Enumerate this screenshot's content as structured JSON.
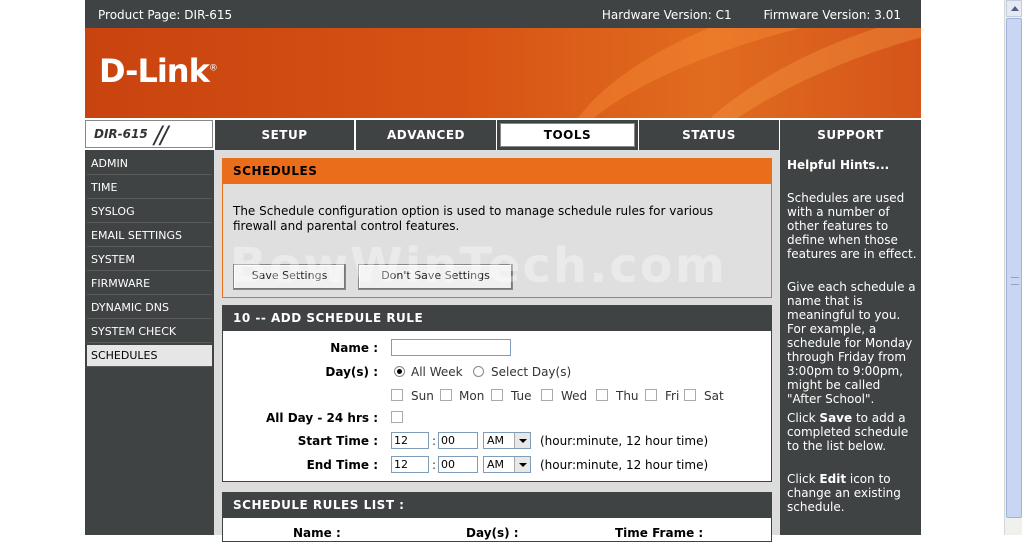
{
  "topbar": {
    "product": "Product Page: DIR-615",
    "hardware": "Hardware Version: C1",
    "firmware": "Firmware Version: 3.01"
  },
  "banner": {
    "logo": "D-Link",
    "logo_mark": "®"
  },
  "model": {
    "name": "DIR-615"
  },
  "nav": {
    "tabs": [
      {
        "label": "SETUP"
      },
      {
        "label": "ADVANCED"
      },
      {
        "label": "TOOLS",
        "active": true
      },
      {
        "label": "STATUS"
      },
      {
        "label": "SUPPORT"
      }
    ]
  },
  "sidebar": {
    "items": [
      {
        "label": "ADMIN"
      },
      {
        "label": "TIME"
      },
      {
        "label": "SYSLOG"
      },
      {
        "label": "EMAIL SETTINGS"
      },
      {
        "label": "SYSTEM"
      },
      {
        "label": "FIRMWARE"
      },
      {
        "label": "DYNAMIC DNS"
      },
      {
        "label": "SYSTEM CHECK"
      },
      {
        "label": "SCHEDULES",
        "active": true
      }
    ]
  },
  "schedules": {
    "title": "SCHEDULES",
    "description": "The Schedule configuration option is used to manage schedule rules for various firewall and parental control features.",
    "save_label": "Save Settings",
    "dont_save_label": "Don't Save Settings"
  },
  "add_rule": {
    "title": "10 -- ADD SCHEDULE RULE",
    "name_label": "Name :",
    "name_value": "",
    "days_label": "Day(s) :",
    "all_week": "All Week",
    "select_days": "Select Day(s)",
    "days": [
      "Sun",
      "Mon",
      "Tue",
      "Wed",
      "Thu",
      "Fri",
      "Sat"
    ],
    "all_day_label": "All Day - 24 hrs :",
    "start_label": "Start Time :",
    "end_label": "End Time :",
    "start_hour": "12",
    "start_min": "00",
    "start_ampm": "AM",
    "end_hour": "12",
    "end_min": "00",
    "end_ampm": "AM",
    "time_sep": ":",
    "time_hint": "(hour:minute, 12 hour time)"
  },
  "rules_list": {
    "title": "SCHEDULE RULES LIST :",
    "col_name": "Name :",
    "col_days": "Day(s) :",
    "col_time": "Time Frame :"
  },
  "hints": {
    "title": "Helpful Hints...",
    "p1": "Schedules are used with a number of other features to define when those features are in effect.",
    "p2": "Give each schedule a name that is meaningful to you. For example, a schedule for Monday through Friday from 3:00pm to 9:00pm, might be called \"After School\".",
    "p3_pre": "Click ",
    "p3_bold": "Save",
    "p3_post": " to add a completed schedule to the list below.",
    "p4_pre": "Click ",
    "p4_bold": "Edit",
    "p4_post": " icon to change an existing schedule."
  },
  "watermark": "BowWinTech.com"
}
